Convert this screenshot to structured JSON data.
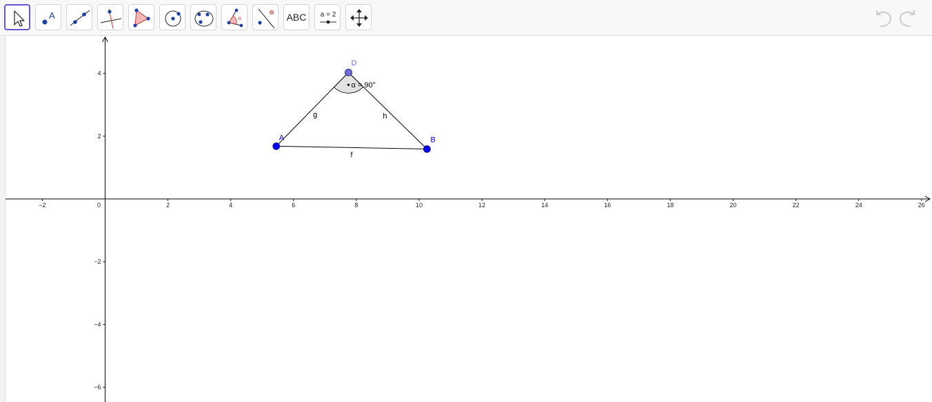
{
  "toolbar": {
    "tools": [
      {
        "name": "move-tool-button",
        "icon": "move-arrow-icon",
        "active": true
      },
      {
        "name": "point-tool-button",
        "icon": "point-icon",
        "icon_text": "A"
      },
      {
        "name": "line-tool-button",
        "icon": "line-through-two-points-icon"
      },
      {
        "name": "perpendicular-line-tool-button",
        "icon": "perpendicular-line-icon"
      },
      {
        "name": "polygon-tool-button",
        "icon": "polygon-icon"
      },
      {
        "name": "circle-tool-button",
        "icon": "circle-with-center-icon"
      },
      {
        "name": "conic-tool-button",
        "icon": "ellipse-icon"
      },
      {
        "name": "angle-tool-button",
        "icon": "angle-icon"
      },
      {
        "name": "reflect-tool-button",
        "icon": "reflect-about-line-icon"
      },
      {
        "name": "text-tool-button",
        "icon": "text-icon",
        "label": "ABC"
      },
      {
        "name": "slider-tool-button",
        "icon": "slider-icon",
        "label": "a = 2"
      },
      {
        "name": "move-graphics-view-tool-button",
        "icon": "move-graphics-view-icon"
      }
    ],
    "undo_icon": "undo-icon",
    "redo_icon": "redo-icon"
  },
  "graphics_view": {
    "x_ticks": [
      {
        "v": -2,
        "label": "−2"
      },
      {
        "v": 0,
        "label": "0"
      },
      {
        "v": 2,
        "label": "2"
      },
      {
        "v": 4,
        "label": "4"
      },
      {
        "v": 6,
        "label": "6"
      },
      {
        "v": 8,
        "label": "8"
      },
      {
        "v": 10,
        "label": "10"
      },
      {
        "v": 12,
        "label": "12"
      },
      {
        "v": 14,
        "label": "14"
      },
      {
        "v": 16,
        "label": "16"
      },
      {
        "v": 18,
        "label": "18"
      },
      {
        "v": 20,
        "label": "20"
      },
      {
        "v": 22,
        "label": "22"
      },
      {
        "v": 24,
        "label": "24"
      },
      {
        "v": 26,
        "label": "26"
      }
    ],
    "y_ticks": [
      {
        "v": 4,
        "label": "4"
      },
      {
        "v": 2,
        "label": "2"
      },
      {
        "v": -2,
        "label": "−2"
      },
      {
        "v": -4,
        "label": "−4"
      },
      {
        "v": -6,
        "label": "−6"
      }
    ],
    "points": [
      {
        "name": "A",
        "x": 5.45,
        "y": 1.68,
        "color": "#0000ff"
      },
      {
        "name": "B",
        "x": 10.25,
        "y": 1.59,
        "color": "#0000ff"
      },
      {
        "name": "D",
        "x": 7.75,
        "y": 4.03,
        "color": "#6b6bdc"
      }
    ],
    "segments": [
      {
        "name": "f",
        "from": "A",
        "to": "B"
      },
      {
        "name": "g",
        "from": "A",
        "to": "D"
      },
      {
        "name": "h",
        "from": "D",
        "to": "B"
      }
    ],
    "angle": {
      "vertex": "D",
      "label": "α = 90°",
      "fill": "#d7dad6"
    }
  }
}
